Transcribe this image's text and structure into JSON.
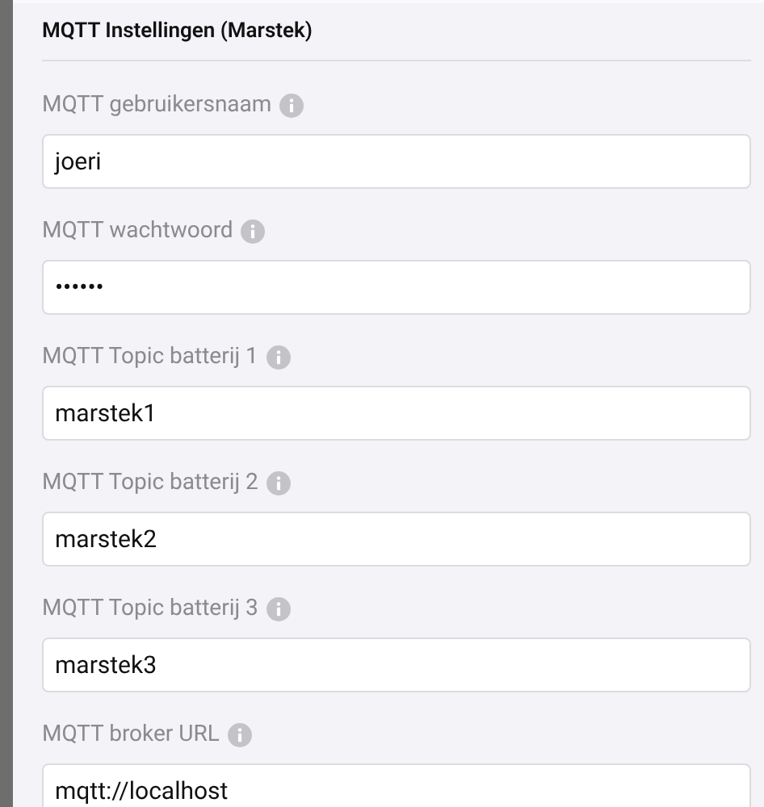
{
  "section": {
    "title": "MQTT Instellingen (Marstek)"
  },
  "fields": [
    {
      "label": "MQTT gebruikersnaam",
      "value": "joeri"
    },
    {
      "label": "MQTT wachtwoord",
      "value": "••••••"
    },
    {
      "label": "MQTT Topic batterij 1",
      "value": "marstek1"
    },
    {
      "label": "MQTT Topic batterij 2",
      "value": "marstek2"
    },
    {
      "label": "MQTT Topic batterij 3",
      "value": "marstek3"
    },
    {
      "label": "MQTT broker URL",
      "value": "mqtt://localhost"
    }
  ]
}
